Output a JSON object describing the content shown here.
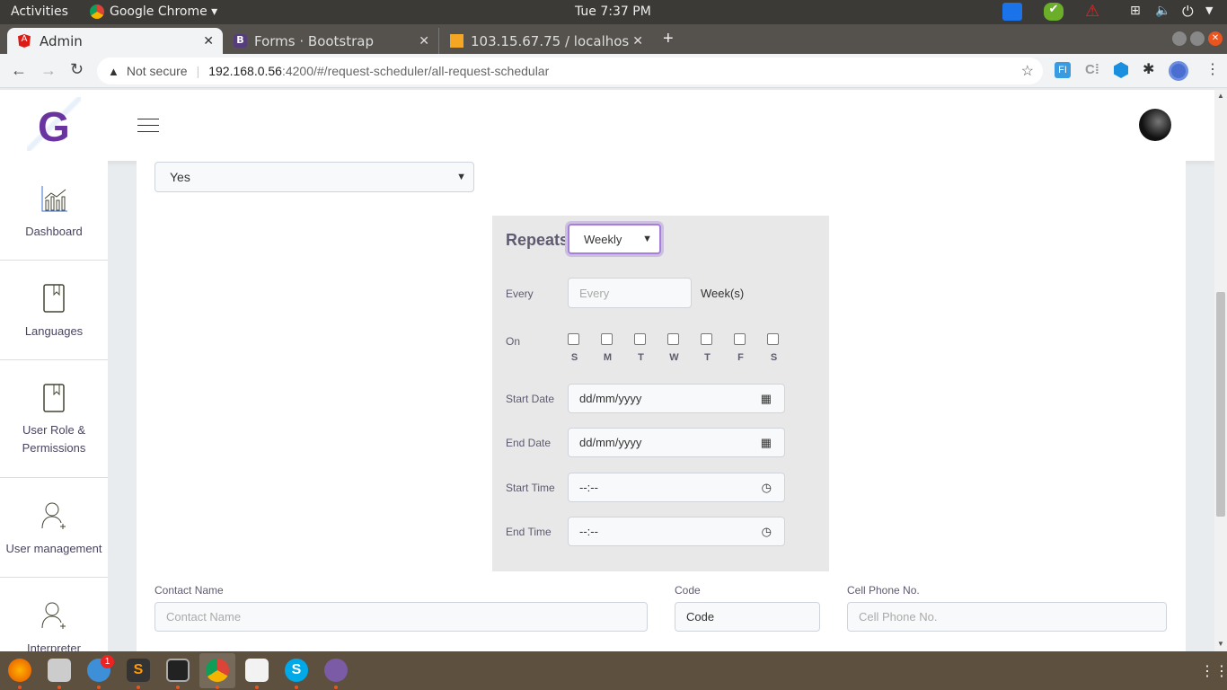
{
  "system": {
    "activities": "Activities",
    "app": "Google Chrome",
    "clock": "Tue  7:37 PM"
  },
  "tabs": [
    {
      "label": "Admin"
    },
    {
      "label": "Forms · Bootstrap"
    },
    {
      "label": "103.15.67.75 / localhost / "
    }
  ],
  "address": {
    "security": "Not secure",
    "host": "192.168.0.56",
    "rest": ":4200/#/request-scheduler/all-request-schedular"
  },
  "logo": "G",
  "sidebar": [
    {
      "label": "Dashboard"
    },
    {
      "label": "Languages"
    },
    {
      "label": "User Role & Permissions"
    },
    {
      "label": "User management"
    },
    {
      "label": "Interpreter"
    }
  ],
  "form": {
    "top_select": "Yes",
    "repeats_label": "Repeats",
    "repeats_value": "Weekly",
    "every_label": "Every",
    "every_placeholder": "Every",
    "every_unit": "Week(s)",
    "on_label": "On",
    "days": [
      "S",
      "M",
      "T",
      "W",
      "T",
      "F",
      "S"
    ],
    "start_date_label": "Start Date",
    "start_date": "dd/mm/yyyy",
    "end_date_label": "End Date",
    "end_date": "dd/mm/yyyy",
    "start_time_label": "Start Time",
    "start_time": "--:--",
    "end_time_label": "End Time",
    "end_time": "--:--",
    "contact_label": "Contact Name",
    "contact_placeholder": "Contact Name",
    "code_label": "Code",
    "code_value": "Code",
    "cell_label": "Cell Phone No.",
    "cell_placeholder": "Cell Phone No."
  },
  "taskbar": {
    "mail_badge": "1"
  }
}
